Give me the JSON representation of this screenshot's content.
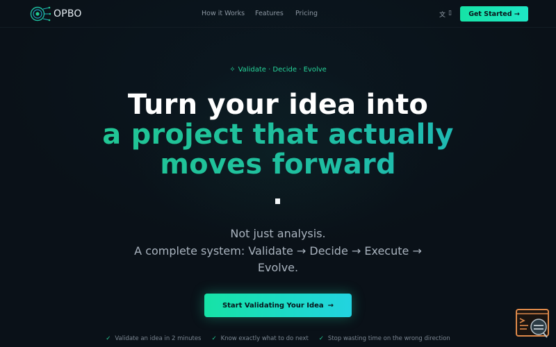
{
  "brand": {
    "name": "OPBO"
  },
  "nav": {
    "links": [
      "How it Works",
      "Features",
      "Pricing"
    ],
    "lang_icon": "translate-icon",
    "cta_label": "Get Started →"
  },
  "hero": {
    "tagline": "Validate · Decide · Evolve",
    "tagline_icon": "sparkle-icon",
    "headline_line1": "Turn your idea into",
    "headline_line2": "a project that actually",
    "headline_line3": "moves forward",
    "subtitle_lines": [
      "Not just analysis.",
      "A complete system: Validate → Decide → Execute →",
      "Evolve."
    ],
    "cta_label": "Start Validating Your Idea",
    "cta_arrow": "→"
  },
  "benefits": [
    "Validate an idea in 2 minutes",
    "Know exactly what to do next",
    "Stop wasting time on the wrong direction"
  ],
  "colors": {
    "background": "#0a1118",
    "accent": "#16e3a6",
    "accent_cyan": "#22d3e0",
    "widget": "#e08a4a"
  }
}
